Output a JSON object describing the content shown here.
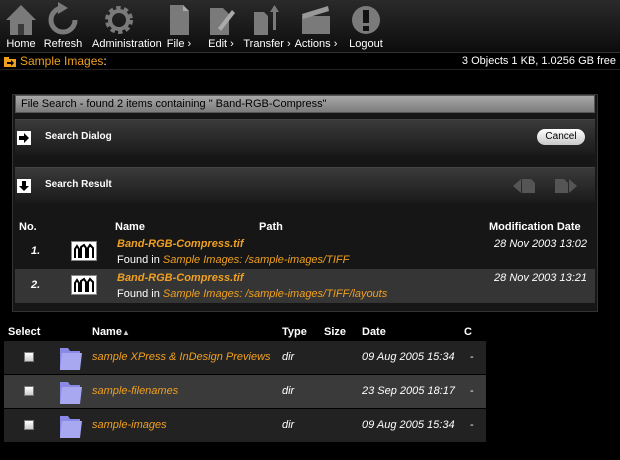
{
  "toolbar": {
    "items": [
      {
        "label": "Home",
        "icon": "home-icon"
      },
      {
        "label": "Refresh",
        "icon": "refresh-icon"
      },
      {
        "label": "Administration",
        "icon": "gear-icon"
      },
      {
        "label": "File ›",
        "icon": "file-icon"
      },
      {
        "label": "Edit ›",
        "icon": "edit-icon"
      },
      {
        "label": "Transfer ›",
        "icon": "transfer-icon"
      },
      {
        "label": "Actions ›",
        "icon": "clapper-icon"
      },
      {
        "label": "Logout",
        "icon": "logout-icon"
      }
    ]
  },
  "location": {
    "title": "Sample Images",
    "colon": ":",
    "info": "3 Objects 1 KB, 1.0256 GB free"
  },
  "search": {
    "title": "File Search - found 2 items containing \" Band-RGB-Compress\"",
    "dialog_label": "Search Dialog",
    "cancel_label": "Cancel",
    "result_label": "Search Result",
    "columns": {
      "no": "No.",
      "name": "Name",
      "path": "Path",
      "date": "Modification Date"
    },
    "results": [
      {
        "no": "1.",
        "name": "Band-RGB-Compress.tif",
        "found_prefix": "Found in",
        "path": "Sample Images: /sample-images/TIFF",
        "date": "28 Nov 2003 13:02"
      },
      {
        "no": "2.",
        "name": "Band-RGB-Compress.tif",
        "found_prefix": "Found in",
        "path": "Sample Images: /sample-images/TIFF/layouts",
        "date": "28 Nov 2003 13:21"
      }
    ]
  },
  "list": {
    "columns": {
      "select": "Select",
      "name": "Name",
      "sort_indicator": "▲",
      "type": "Type",
      "size": "Size",
      "date": "Date",
      "c": "C"
    },
    "rows": [
      {
        "name": "sample XPress & InDesign Previews",
        "type": "dir",
        "date": "09 Aug 2005 15:34",
        "c": "-"
      },
      {
        "name": "sample-filenames",
        "type": "dir",
        "date": "23 Sep 2005 18:17",
        "c": "-"
      },
      {
        "name": "sample-images",
        "type": "dir",
        "date": "09 Aug 2005 15:34",
        "c": "-"
      }
    ]
  },
  "colors": {
    "accent": "#f0a020",
    "background": "#000000",
    "panel": "#161616"
  }
}
